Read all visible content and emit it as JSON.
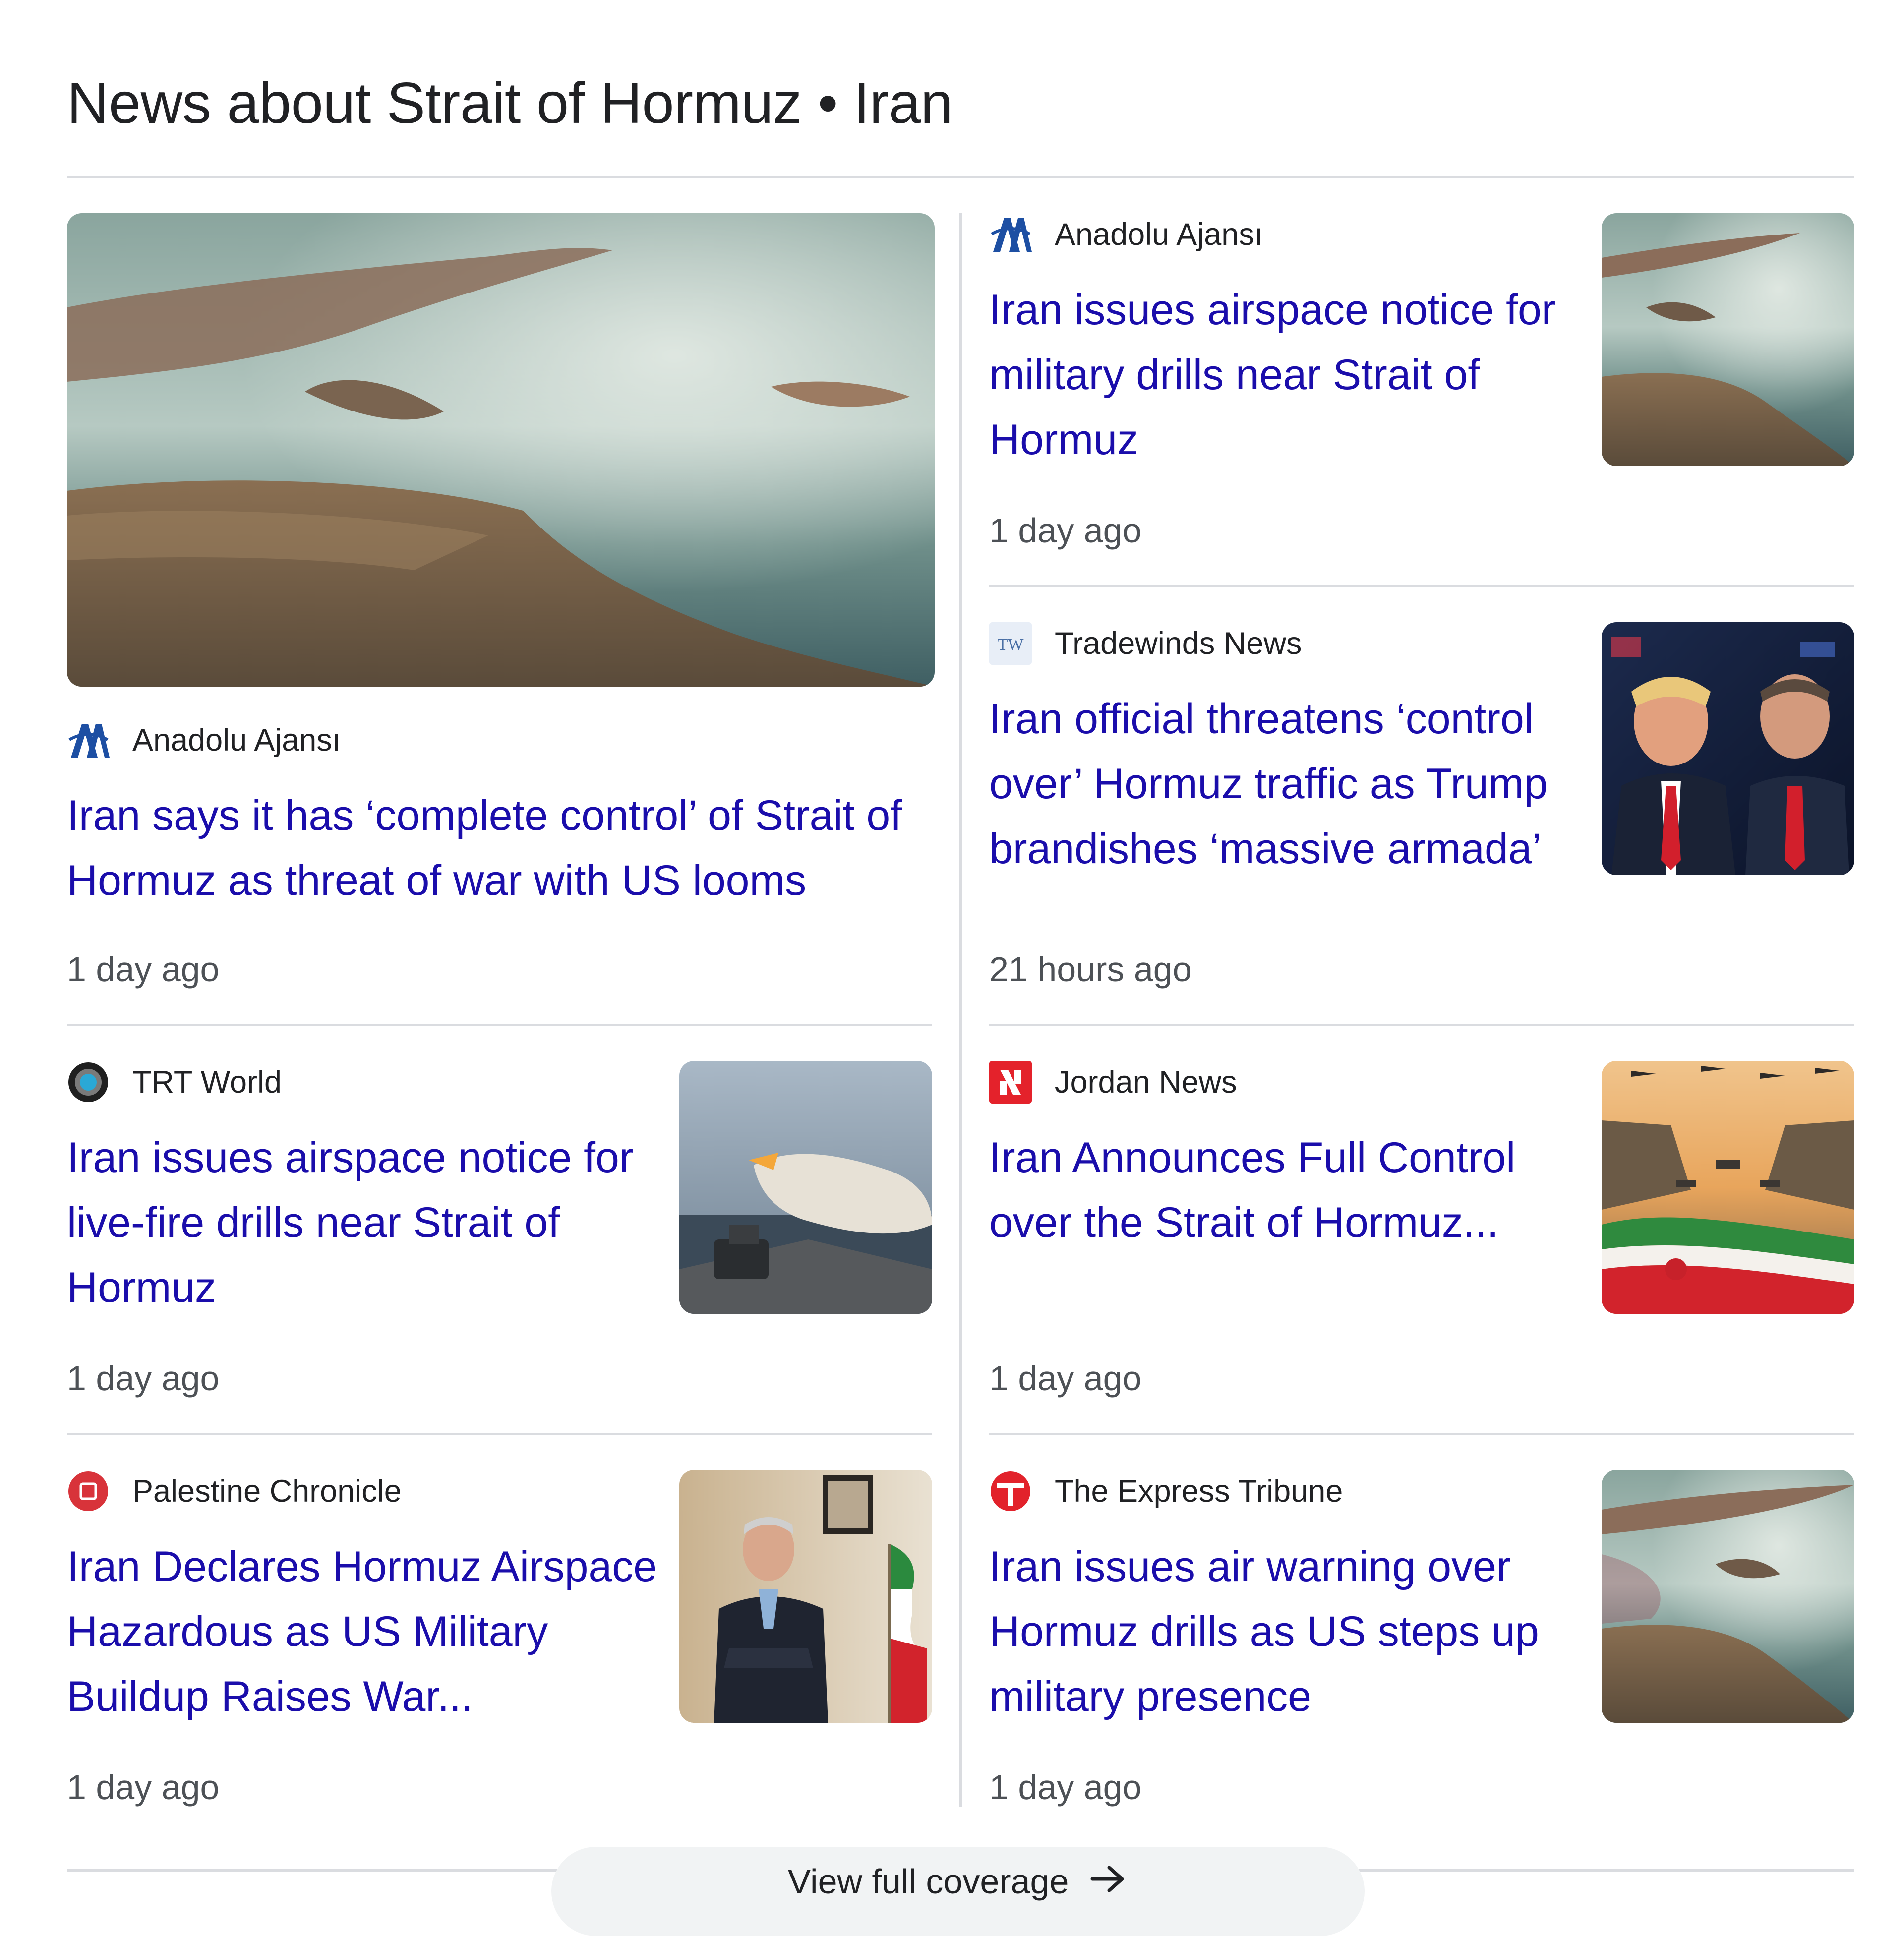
{
  "header": {
    "title": "News about Strait of Hormuz • Iran"
  },
  "articles": [
    {
      "source": "Anadolu Ajansı",
      "headline": "Iran says it has ‘complete control’ of Strait of Hormuz as threat of war with US looms",
      "time": "1 day ago",
      "logo": "anadolu-logo"
    },
    {
      "source": "Anadolu Ajansı",
      "headline": "Iran issues airspace notice for military drills near Strait of Hormuz",
      "time": "1 day ago",
      "logo": "anadolu-logo"
    },
    {
      "source": "Tradewinds News",
      "headline": "Iran official threatens ‘control over’ Hormuz traffic as Trump brandishes ‘massive armada’",
      "time": "21 hours ago",
      "logo": "tradewinds-logo",
      "logo_text": "TW"
    },
    {
      "source": "TRT World",
      "headline": "Iran issues airspace notice for live-fire drills near Strait of Hormuz",
      "time": "1 day ago",
      "logo": "trt-world-logo"
    },
    {
      "source": "Jordan News",
      "headline": "Iran Announces Full Control over the Strait of Hormuz...",
      "time": "1 day ago",
      "logo": "jordan-news-logo"
    },
    {
      "source": "Palestine Chronicle",
      "headline": "Iran Declares Hormuz Airspace Hazardous as US Military Buildup Raises War...",
      "time": "1 day ago",
      "logo": "palestine-chronicle-logo"
    },
    {
      "source": "The Express Tribune",
      "headline": "Iran issues air warning over Hormuz drills as US steps up military presence",
      "time": "1 day ago",
      "logo": "express-tribune-logo"
    }
  ],
  "footer": {
    "view_full_label": "View full coverage",
    "arrow_icon": "arrow-right-icon"
  },
  "colors": {
    "link": "#1a0dab",
    "divider": "#dadce0",
    "time": "#4d5156"
  }
}
